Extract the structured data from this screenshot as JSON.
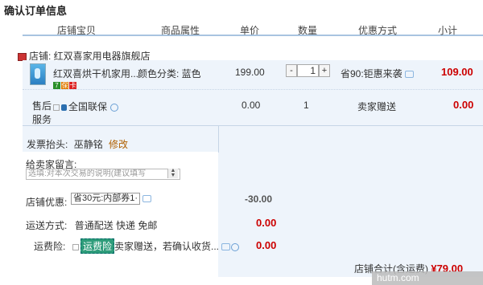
{
  "page": {
    "title": "确认订单信息"
  },
  "columns": [
    "店铺宝贝",
    "商品属性",
    "单价",
    "数量",
    "优惠方式",
    "小计"
  ],
  "shop": {
    "label": "店铺: 红双喜家用电器旗舰店"
  },
  "item": {
    "name": "红双喜烘干机家用...",
    "attr": "颜色分类: 蓝色",
    "price": "199.00",
    "qty": "1",
    "minus": "-",
    "plus": "+",
    "promo": "省90:钜惠来袭",
    "subtotal": "109.00",
    "badges": [
      "7",
      "保",
      "卡"
    ]
  },
  "after_sales": {
    "label_line1": "售后",
    "label_line2": "服务",
    "service": "全国联保",
    "price": "0.00",
    "qty": "1",
    "promo": "卖家赠送",
    "subtotal": "0.00"
  },
  "invoice": {
    "label": "发票抬头:",
    "value": "巫静铭",
    "edit": "修改"
  },
  "message": {
    "label": "给卖家留言:",
    "placeholder": "选填:对本次交易的说明(建议填写"
  },
  "discount": {
    "label": "店铺优惠:",
    "selected": "省30元:内部券1·",
    "amount": "-30.00"
  },
  "shipping": {
    "label": "运送方式:",
    "value": "普通配送 快递 免邮",
    "amount": "0.00"
  },
  "insurance": {
    "label": "运费险:",
    "tag": "运费险",
    "desc": "卖家赠送，若确认收货...",
    "amount": "0.00"
  },
  "total": {
    "label": "店铺合计(含运费)",
    "amount": "¥79.00"
  },
  "watermark": {
    "text": "hutm.com"
  },
  "colors": {
    "price_red": "#cc0000",
    "header_border": "#a8c4e0",
    "panel_bg": "#eef4fb"
  }
}
